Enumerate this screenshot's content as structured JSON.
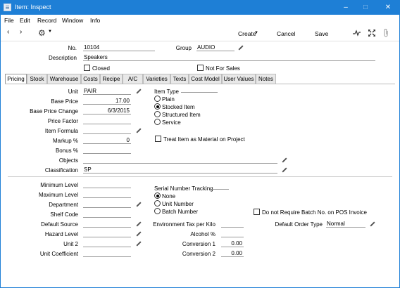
{
  "window": {
    "title": "Item: Inspect"
  },
  "menu": [
    "File",
    "Edit",
    "Record",
    "Window",
    "Info"
  ],
  "toolbar": {
    "prev": "‹",
    "next": "›",
    "create": "Create",
    "cancel": "Cancel",
    "save": "Save"
  },
  "header": {
    "no_label": "No.",
    "no_value": "10104",
    "group_label": "Group",
    "group_value": "AUDIO",
    "description_label": "Description",
    "description_value": "Speakers",
    "closed_label": "Closed",
    "not_for_sales_label": "Not For Sales"
  },
  "tabs": [
    "Pricing",
    "Stock",
    "Warehouse",
    "Costs",
    "Recipe",
    "A/C",
    "Varieties",
    "Texts",
    "Cost Model",
    "User Values",
    "Notes"
  ],
  "pricing": {
    "unit_label": "Unit",
    "unit_value": "PAIR",
    "base_price_label": "Base Price",
    "base_price_value": "17.00",
    "base_price_change_label": "Base Price Change",
    "base_price_change_value": "6/3/2015",
    "price_factor_label": "Price Factor",
    "price_factor_value": "",
    "item_formula_label": "Item Formula",
    "item_formula_value": "",
    "markup_label": "Markup %",
    "markup_value": "0",
    "bonus_label": "Bonus %",
    "bonus_value": "",
    "objects_label": "Objects",
    "objects_value": "",
    "classification_label": "Classification",
    "classification_value": "SP",
    "item_type_label": "Item Type",
    "item_types": [
      "Plain",
      "Stocked Item",
      "Structured Item",
      "Service"
    ],
    "item_type_selected": "Stocked Item",
    "treat_as_material_label": "Treat Item as Material on Project"
  },
  "stock": {
    "min_level_label": "Minimum Level",
    "max_level_label": "Maximum Level",
    "department_label": "Department",
    "shelf_code_label": "Shelf Code",
    "default_source_label": "Default Source",
    "hazard_level_label": "Hazard Level",
    "unit2_label": "Unit 2",
    "unit_coefficient_label": "Unit Coefficient",
    "serial_tracking_label": "Serial Number Tracking",
    "serial_options": [
      "None",
      "Unit Number",
      "Batch Number"
    ],
    "serial_selected": "None",
    "env_tax_label": "Environment Tax per Kilo",
    "env_tax_value": "",
    "alcohol_label": "Alcohol %",
    "alcohol_value": "",
    "conversion1_label": "Conversion 1",
    "conversion1_value": "0.00",
    "conversion2_label": "Conversion 2",
    "conversion2_value": "0.00",
    "no_batch_label": "Do not Require Batch No. on POS Invoice",
    "default_order_type_label": "Default Order Type",
    "default_order_type_value": "Normal"
  }
}
